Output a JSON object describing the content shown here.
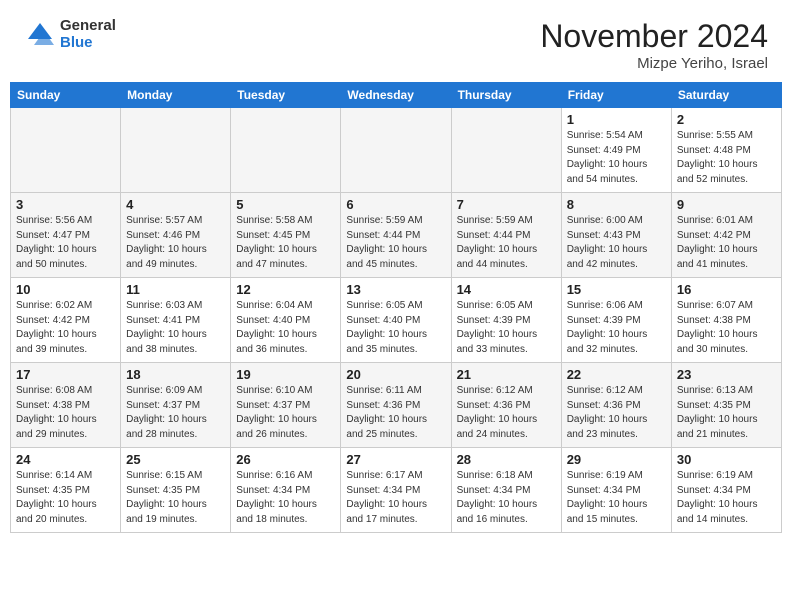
{
  "header": {
    "logo_general": "General",
    "logo_blue": "Blue",
    "month_title": "November 2024",
    "location": "Mizpe Yeriho, Israel"
  },
  "calendar": {
    "days_of_week": [
      "Sunday",
      "Monday",
      "Tuesday",
      "Wednesday",
      "Thursday",
      "Friday",
      "Saturday"
    ],
    "weeks": [
      [
        {
          "day": "",
          "info": ""
        },
        {
          "day": "",
          "info": ""
        },
        {
          "day": "",
          "info": ""
        },
        {
          "day": "",
          "info": ""
        },
        {
          "day": "",
          "info": ""
        },
        {
          "day": "1",
          "info": "Sunrise: 5:54 AM\nSunset: 4:49 PM\nDaylight: 10 hours\nand 54 minutes."
        },
        {
          "day": "2",
          "info": "Sunrise: 5:55 AM\nSunset: 4:48 PM\nDaylight: 10 hours\nand 52 minutes."
        }
      ],
      [
        {
          "day": "3",
          "info": "Sunrise: 5:56 AM\nSunset: 4:47 PM\nDaylight: 10 hours\nand 50 minutes."
        },
        {
          "day": "4",
          "info": "Sunrise: 5:57 AM\nSunset: 4:46 PM\nDaylight: 10 hours\nand 49 minutes."
        },
        {
          "day": "5",
          "info": "Sunrise: 5:58 AM\nSunset: 4:45 PM\nDaylight: 10 hours\nand 47 minutes."
        },
        {
          "day": "6",
          "info": "Sunrise: 5:59 AM\nSunset: 4:44 PM\nDaylight: 10 hours\nand 45 minutes."
        },
        {
          "day": "7",
          "info": "Sunrise: 5:59 AM\nSunset: 4:44 PM\nDaylight: 10 hours\nand 44 minutes."
        },
        {
          "day": "8",
          "info": "Sunrise: 6:00 AM\nSunset: 4:43 PM\nDaylight: 10 hours\nand 42 minutes."
        },
        {
          "day": "9",
          "info": "Sunrise: 6:01 AM\nSunset: 4:42 PM\nDaylight: 10 hours\nand 41 minutes."
        }
      ],
      [
        {
          "day": "10",
          "info": "Sunrise: 6:02 AM\nSunset: 4:42 PM\nDaylight: 10 hours\nand 39 minutes."
        },
        {
          "day": "11",
          "info": "Sunrise: 6:03 AM\nSunset: 4:41 PM\nDaylight: 10 hours\nand 38 minutes."
        },
        {
          "day": "12",
          "info": "Sunrise: 6:04 AM\nSunset: 4:40 PM\nDaylight: 10 hours\nand 36 minutes."
        },
        {
          "day": "13",
          "info": "Sunrise: 6:05 AM\nSunset: 4:40 PM\nDaylight: 10 hours\nand 35 minutes."
        },
        {
          "day": "14",
          "info": "Sunrise: 6:05 AM\nSunset: 4:39 PM\nDaylight: 10 hours\nand 33 minutes."
        },
        {
          "day": "15",
          "info": "Sunrise: 6:06 AM\nSunset: 4:39 PM\nDaylight: 10 hours\nand 32 minutes."
        },
        {
          "day": "16",
          "info": "Sunrise: 6:07 AM\nSunset: 4:38 PM\nDaylight: 10 hours\nand 30 minutes."
        }
      ],
      [
        {
          "day": "17",
          "info": "Sunrise: 6:08 AM\nSunset: 4:38 PM\nDaylight: 10 hours\nand 29 minutes."
        },
        {
          "day": "18",
          "info": "Sunrise: 6:09 AM\nSunset: 4:37 PM\nDaylight: 10 hours\nand 28 minutes."
        },
        {
          "day": "19",
          "info": "Sunrise: 6:10 AM\nSunset: 4:37 PM\nDaylight: 10 hours\nand 26 minutes."
        },
        {
          "day": "20",
          "info": "Sunrise: 6:11 AM\nSunset: 4:36 PM\nDaylight: 10 hours\nand 25 minutes."
        },
        {
          "day": "21",
          "info": "Sunrise: 6:12 AM\nSunset: 4:36 PM\nDaylight: 10 hours\nand 24 minutes."
        },
        {
          "day": "22",
          "info": "Sunrise: 6:12 AM\nSunset: 4:36 PM\nDaylight: 10 hours\nand 23 minutes."
        },
        {
          "day": "23",
          "info": "Sunrise: 6:13 AM\nSunset: 4:35 PM\nDaylight: 10 hours\nand 21 minutes."
        }
      ],
      [
        {
          "day": "24",
          "info": "Sunrise: 6:14 AM\nSunset: 4:35 PM\nDaylight: 10 hours\nand 20 minutes."
        },
        {
          "day": "25",
          "info": "Sunrise: 6:15 AM\nSunset: 4:35 PM\nDaylight: 10 hours\nand 19 minutes."
        },
        {
          "day": "26",
          "info": "Sunrise: 6:16 AM\nSunset: 4:34 PM\nDaylight: 10 hours\nand 18 minutes."
        },
        {
          "day": "27",
          "info": "Sunrise: 6:17 AM\nSunset: 4:34 PM\nDaylight: 10 hours\nand 17 minutes."
        },
        {
          "day": "28",
          "info": "Sunrise: 6:18 AM\nSunset: 4:34 PM\nDaylight: 10 hours\nand 16 minutes."
        },
        {
          "day": "29",
          "info": "Sunrise: 6:19 AM\nSunset: 4:34 PM\nDaylight: 10 hours\nand 15 minutes."
        },
        {
          "day": "30",
          "info": "Sunrise: 6:19 AM\nSunset: 4:34 PM\nDaylight: 10 hours\nand 14 minutes."
        }
      ]
    ]
  }
}
